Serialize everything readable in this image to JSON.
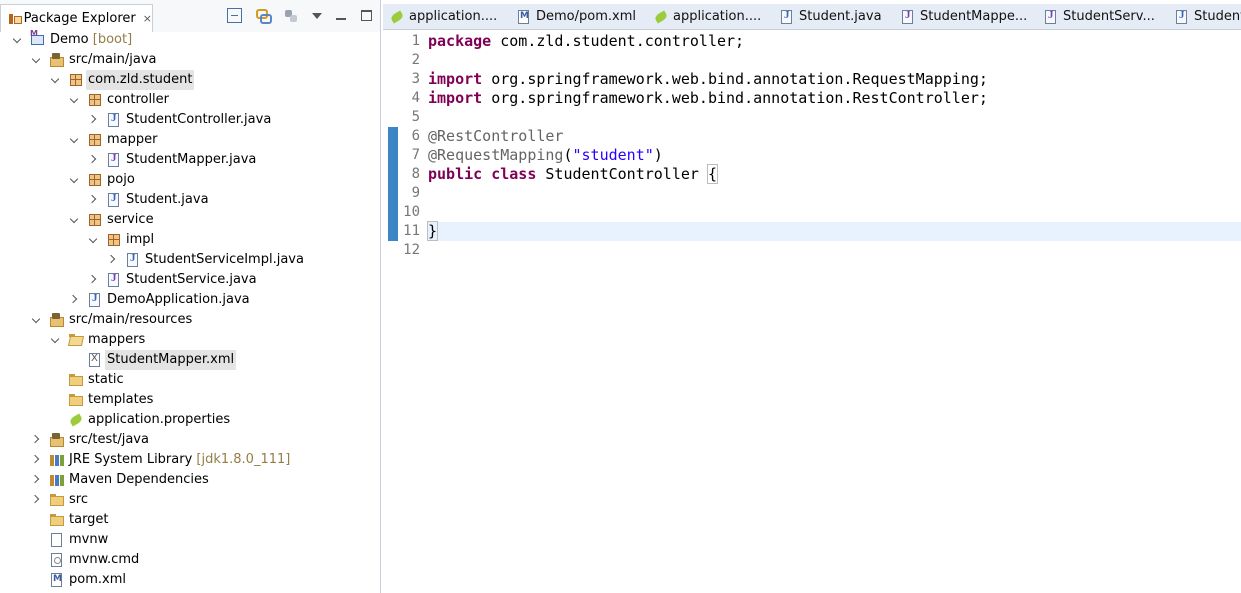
{
  "explorer": {
    "title": "Package Explorer",
    "close": "×",
    "toolbar_icons": [
      "collapse-all-icon",
      "link-with-editor-icon",
      "focus-icon",
      "view-menu-icon",
      "minimize-icon",
      "maximize-icon"
    ],
    "tree": [
      {
        "depth": 0,
        "toggle": "expanded",
        "icon": "project",
        "label": "Demo",
        "decoration": " [boot]"
      },
      {
        "depth": 1,
        "toggle": "expanded",
        "icon": "srcfolder",
        "label": "src/main/java"
      },
      {
        "depth": 2,
        "toggle": "expanded",
        "icon": "package",
        "label": "com.zld.student",
        "selected": true
      },
      {
        "depth": 3,
        "toggle": "expanded",
        "icon": "package",
        "label": "controller"
      },
      {
        "depth": 4,
        "toggle": "collapsed",
        "icon": "javafile",
        "label": "StudentController.java"
      },
      {
        "depth": 3,
        "toggle": "expanded",
        "icon": "package",
        "label": "mapper"
      },
      {
        "depth": 4,
        "toggle": "collapsed",
        "icon": "interfacefile",
        "label": "StudentMapper.java"
      },
      {
        "depth": 3,
        "toggle": "expanded",
        "icon": "package",
        "label": "pojo"
      },
      {
        "depth": 4,
        "toggle": "collapsed",
        "icon": "javafile",
        "label": "Student.java"
      },
      {
        "depth": 3,
        "toggle": "expanded",
        "icon": "package",
        "label": "service"
      },
      {
        "depth": 4,
        "toggle": "expanded",
        "icon": "package",
        "label": "impl"
      },
      {
        "depth": 5,
        "toggle": "collapsed",
        "icon": "javafile",
        "label": "StudentServiceImpl.java"
      },
      {
        "depth": 4,
        "toggle": "collapsed",
        "icon": "interfacefile",
        "label": "StudentService.java"
      },
      {
        "depth": 3,
        "toggle": "collapsed",
        "icon": "javafile",
        "label": "DemoApplication.java"
      },
      {
        "depth": 1,
        "toggle": "expanded",
        "icon": "srcfolder",
        "label": "src/main/resources"
      },
      {
        "depth": 2,
        "toggle": "expanded",
        "icon": "openfolder",
        "label": "mappers"
      },
      {
        "depth": 3,
        "toggle": "none",
        "icon": "xmlfile",
        "label": "StudentMapper.xml",
        "highlight": true
      },
      {
        "depth": 2,
        "toggle": "none",
        "icon": "folder",
        "label": "static"
      },
      {
        "depth": 2,
        "toggle": "none",
        "icon": "folder",
        "label": "templates"
      },
      {
        "depth": 2,
        "toggle": "none",
        "icon": "properties",
        "label": "application.properties"
      },
      {
        "depth": 1,
        "toggle": "collapsed",
        "icon": "srcfolder",
        "label": "src/test/java"
      },
      {
        "depth": 1,
        "toggle": "collapsed",
        "icon": "library",
        "label": "JRE System Library",
        "decoration": " [jdk1.8.0_111]"
      },
      {
        "depth": 1,
        "toggle": "collapsed",
        "icon": "library",
        "label": "Maven Dependencies"
      },
      {
        "depth": 1,
        "toggle": "collapsed",
        "icon": "folder",
        "label": "src"
      },
      {
        "depth": 1,
        "toggle": "none",
        "icon": "folder",
        "label": "target"
      },
      {
        "depth": 1,
        "toggle": "none",
        "icon": "plainfile",
        "label": "mvnw"
      },
      {
        "depth": 1,
        "toggle": "none",
        "icon": "cmdfile",
        "label": "mvnw.cmd"
      },
      {
        "depth": 1,
        "toggle": "none",
        "icon": "pomfile",
        "label": "pom.xml"
      }
    ]
  },
  "editor": {
    "tabs": [
      {
        "label": "application....",
        "icon": "properties"
      },
      {
        "label": "Demo/pom.xml",
        "icon": "pomfile"
      },
      {
        "label": "application....",
        "icon": "properties"
      },
      {
        "label": "Student.java",
        "icon": "javafile"
      },
      {
        "label": "StudentMappe...",
        "icon": "interfacefile"
      },
      {
        "label": "StudentServ...",
        "icon": "interfacefile"
      },
      {
        "label": "StudentS",
        "icon": "javafile"
      }
    ],
    "line_numbers": [
      "1",
      "2",
      "3",
      "4",
      "5",
      "6",
      "7",
      "8",
      "9",
      "10",
      "11",
      "12"
    ],
    "current_line": 11,
    "code_lines": [
      [
        {
          "t": "package",
          "c": "kw"
        },
        {
          "t": " com.zld.student.controller;"
        }
      ],
      [],
      [
        {
          "t": "import",
          "c": "kw"
        },
        {
          "t": " org.springframework.web.bind.annotation.RequestMapping;"
        }
      ],
      [
        {
          "t": "import",
          "c": "kw"
        },
        {
          "t": " org.springframework.web.bind.annotation.RestController;"
        }
      ],
      [],
      [
        {
          "t": "@RestController",
          "c": "ann"
        }
      ],
      [
        {
          "t": "@RequestMapping",
          "c": "ann"
        },
        {
          "t": "("
        },
        {
          "t": "\"student\"",
          "c": "str"
        },
        {
          "t": ")"
        }
      ],
      [
        {
          "t": "public",
          "c": "kw"
        },
        {
          "t": " "
        },
        {
          "t": "class",
          "c": "kw"
        },
        {
          "t": " StudentController "
        },
        {
          "t": "{",
          "c": "bracket"
        }
      ],
      [],
      [],
      [
        {
          "t": "}",
          "c": "bracket"
        },
        {
          "t": "",
          "c": "caret"
        }
      ],
      []
    ]
  }
}
